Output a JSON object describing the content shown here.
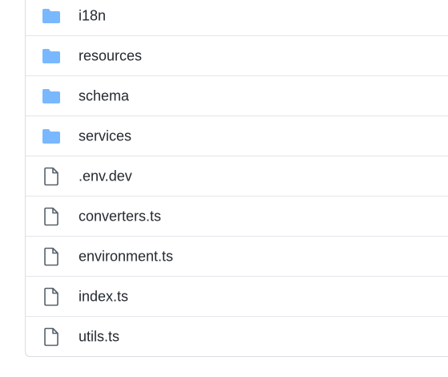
{
  "file_list": {
    "items": [
      {
        "name": "i18n",
        "type": "folder",
        "icon": "folder-icon"
      },
      {
        "name": "resources",
        "type": "folder",
        "icon": "folder-icon"
      },
      {
        "name": "schema",
        "type": "folder",
        "icon": "folder-icon"
      },
      {
        "name": "services",
        "type": "folder",
        "icon": "folder-icon"
      },
      {
        "name": ".env.dev",
        "type": "file",
        "icon": "file-icon"
      },
      {
        "name": "converters.ts",
        "type": "file",
        "icon": "file-icon"
      },
      {
        "name": "environment.ts",
        "type": "file",
        "icon": "file-icon"
      },
      {
        "name": "index.ts",
        "type": "file",
        "icon": "file-icon"
      },
      {
        "name": "utils.ts",
        "type": "file",
        "icon": "file-icon"
      }
    ]
  },
  "colors": {
    "folder": "#79b8ff",
    "file_outline": "#57606a",
    "text": "#24292f",
    "divider": "#e3e6ea"
  }
}
